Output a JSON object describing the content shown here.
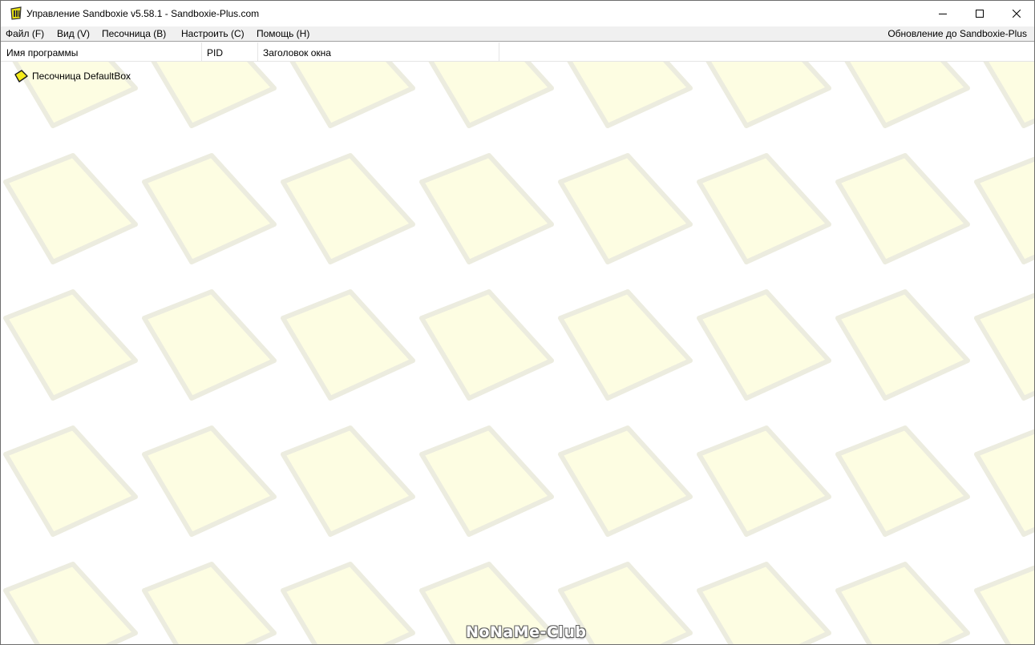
{
  "window": {
    "title": "Управление Sandboxie v5.58.1 - Sandboxie-Plus.com"
  },
  "menu": {
    "file": "Файл (F)",
    "view": "Вид (V)",
    "sandbox": "Песочница (B)",
    "configure": "Настроить (C)",
    "help": "Помощь (H)",
    "update": "Обновление до Sandboxie-Plus"
  },
  "columns": {
    "program_name": "Имя программы",
    "pid": "PID",
    "window_title": "Заголовок окна"
  },
  "tree": {
    "sandbox_label": "Песочница DefaultBox"
  },
  "watermark": "NoNaMe-Club",
  "colors": {
    "background_pattern": "#fdfde0",
    "pattern_border": "#ebebe0",
    "menu_bg": "#f0f0f0",
    "icon_yellow": "#f5ec1a"
  }
}
